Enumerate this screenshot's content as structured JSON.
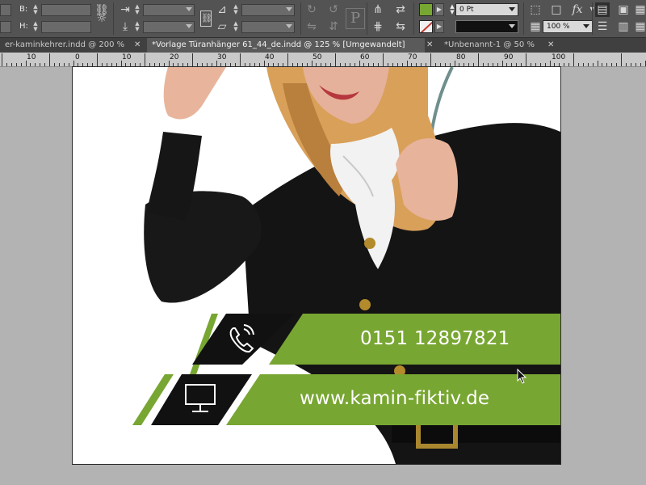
{
  "control_panel": {
    "w_label": "B:",
    "h_label": "H:",
    "stroke_weight": "0 Pt",
    "opacity": "100 %",
    "colors": {
      "fill": "#78a632",
      "stroke_none": "#c3322c"
    }
  },
  "tabs": [
    {
      "label": "er-kaminkehrer.indd @ 200 %"
    },
    {
      "label": "*Vorlage Türanhänger 61_44_de.indd @ 125 % [Umgewandelt]"
    },
    {
      "label": "*Unbenannt-1 @ 50 %"
    }
  ],
  "ruler": {
    "labels": [
      "10",
      "0",
      "10",
      "20",
      "30",
      "40",
      "50",
      "60",
      "70",
      "80",
      "90",
      "100"
    ]
  },
  "design": {
    "phone": "0151 12897821",
    "website": "www.kamin-fiktiv.de",
    "accent_color": "#78a632"
  }
}
